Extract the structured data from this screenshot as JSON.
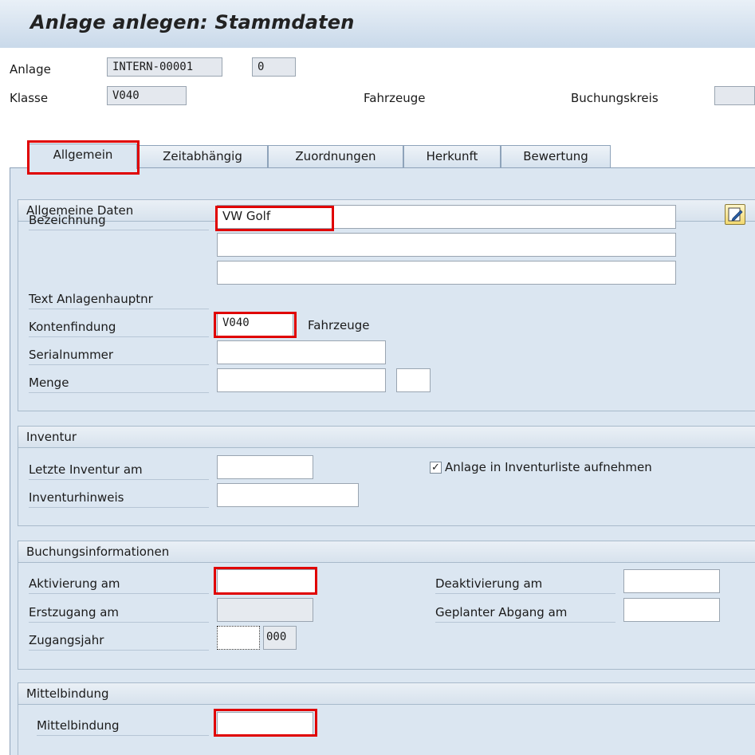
{
  "title": "Anlage anlegen:  Stammdaten",
  "header": {
    "anlage_label": "Anlage",
    "anlage_value": "INTERN-00001",
    "unternummer_value": "0",
    "klasse_label": "Klasse",
    "klasse_value": "V040",
    "klasse_text": "Fahrzeuge",
    "buchungskreis_label": "Buchungskreis",
    "buchungskreis_value": ""
  },
  "tabs": [
    {
      "label": "Allgemein",
      "active": true
    },
    {
      "label": "Zeitabhängig"
    },
    {
      "label": "Zuordnungen"
    },
    {
      "label": "Herkunft"
    },
    {
      "label": "Bewertung"
    }
  ],
  "allgemeine_daten": {
    "title": "Allgemeine Daten",
    "bezeichnung_label": "Bezeichnung",
    "bezeichnung_value": "VW Golf",
    "bezeichnung2_value": "",
    "text_anlagenhauptnr_label": "Text Anlagenhauptnr",
    "text_anlagenhauptnr_value": "",
    "kontenfindung_label": "Kontenfindung",
    "kontenfindung_value": "V040",
    "kontenfindung_text": "Fahrzeuge",
    "serialnummer_label": "Serialnummer",
    "serialnummer_value": "",
    "menge_label": "Menge",
    "menge_value": "",
    "menge_unit": ""
  },
  "inventur": {
    "title": "Inventur",
    "letzte_inventur_label": "Letzte Inventur am",
    "letzte_inventur_value": "",
    "inventurliste_label": "Anlage in Inventurliste aufnehmen",
    "inventurliste_checked": true,
    "inventurhinweis_label": "Inventurhinweis",
    "inventurhinweis_value": ""
  },
  "buchungsinformationen": {
    "title": "Buchungsinformationen",
    "aktivierung_label": "Aktivierung am",
    "aktivierung_value": "",
    "deaktivierung_label": "Deaktivierung am",
    "deaktivierung_value": "",
    "erstzugang_label": "Erstzugang am",
    "erstzugang_value": "",
    "geplanter_abgang_label": "Geplanter Abgang am",
    "geplanter_abgang_value": "",
    "zugangsjahr_label": "Zugangsjahr",
    "zugangsjahr_period": "",
    "zugangsjahr_value": "000"
  },
  "mittelbindung": {
    "title": "Mittelbindung",
    "mittelbindung_label": "Mittelbindung",
    "mittelbindung_value": ""
  },
  "colors": {
    "highlight": "#e00000",
    "panel_bg": "#dbe6f1",
    "title_gradient_top": "#e9f0f7",
    "title_gradient_bottom": "#c9d9ea"
  },
  "icons": {
    "edit": "edit-pencil-icon",
    "check": "checkmark-icon"
  }
}
